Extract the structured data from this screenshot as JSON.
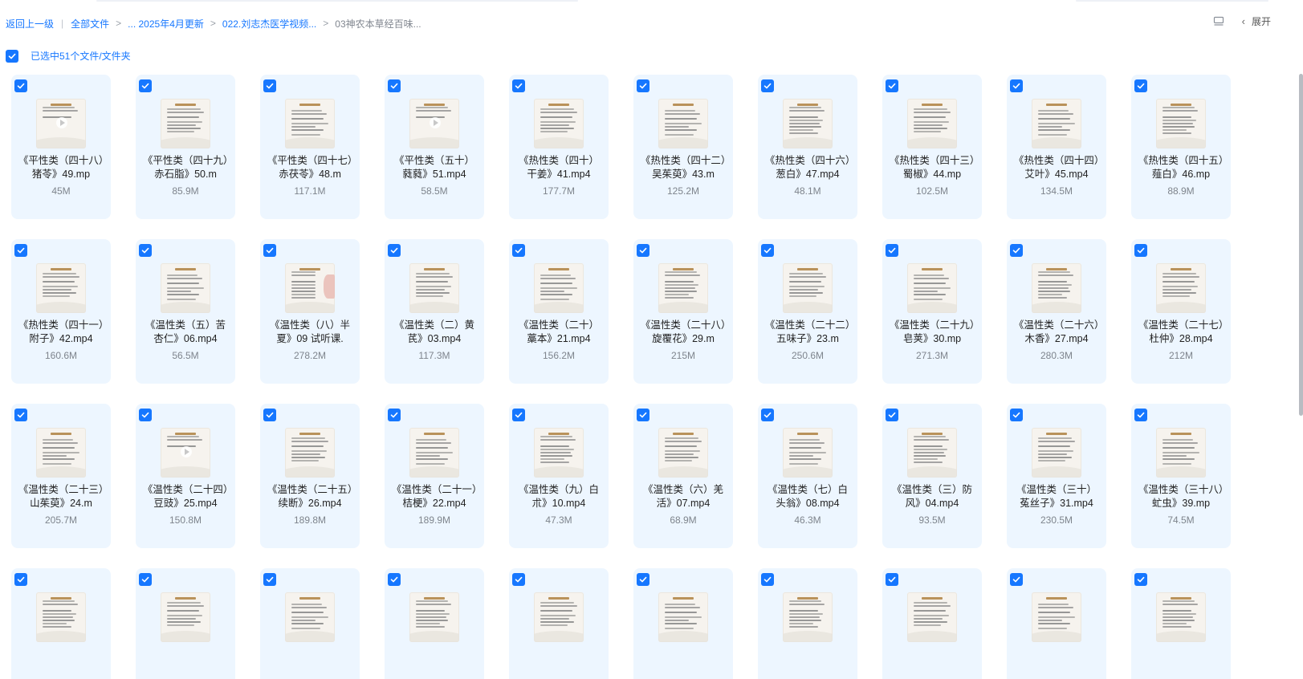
{
  "breadcrumb": {
    "back": "返回上一级",
    "items": [
      "全部文件",
      "... 2025年4月更新",
      "022.刘志杰医学视频...",
      "03神农本草经百味..."
    ]
  },
  "toolbar": {
    "list_view_icon": "list-view-icon",
    "expand_label": "展开"
  },
  "selection": {
    "label": "已选中51个文件/文件夹",
    "checked": true
  },
  "colors": {
    "accent": "#1677ff",
    "card_bg": "#edf6ff"
  },
  "files": [
    {
      "name": "《平性类（四十八）猪苓》49.mp",
      "size": "45M",
      "thumb": "cover"
    },
    {
      "name": "《平性类（四十九）赤石脂》50.m",
      "size": "85.9M",
      "thumb": "doc"
    },
    {
      "name": "《平性类（四十七）赤茯苓》48.m",
      "size": "117.1M",
      "thumb": "doc"
    },
    {
      "name": "《平性类（五十）蕤蕤》51.mp4",
      "size": "58.5M",
      "thumb": "cover"
    },
    {
      "name": "《热性类（四十）干姜》41.mp4",
      "size": "177.7M",
      "thumb": "doc"
    },
    {
      "name": "《热性类（四十二）吴茱萸》43.m",
      "size": "125.2M",
      "thumb": "doc"
    },
    {
      "name": "《热性类（四十六）葱白》47.mp4",
      "size": "48.1M",
      "thumb": "doc"
    },
    {
      "name": "《热性类（四十三）蜀椒》44.mp",
      "size": "102.5M",
      "thumb": "doc"
    },
    {
      "name": "《热性类（四十四）艾叶》45.mp4",
      "size": "134.5M",
      "thumb": "doc"
    },
    {
      "name": "《热性类（四十五）薤白》46.mp",
      "size": "88.9M",
      "thumb": "doc"
    },
    {
      "name": "《热性类（四十一）附子》42.mp4",
      "size": "160.6M",
      "thumb": "doc"
    },
    {
      "name": "《温性类（五）苦杏仁》06.mp4",
      "size": "56.5M",
      "thumb": "doc"
    },
    {
      "name": "《温性类（八）半夏》09 试听课.",
      "size": "278.2M",
      "thumb": "flower"
    },
    {
      "name": "《温性类（二）黄芪》03.mp4",
      "size": "117.3M",
      "thumb": "doc"
    },
    {
      "name": "《温性类（二十）藁本》21.mp4",
      "size": "156.2M",
      "thumb": "doc"
    },
    {
      "name": "《温性类（二十八）旋覆花》29.m",
      "size": "215M",
      "thumb": "doc"
    },
    {
      "name": "《温性类（二十二）五味子》23.m",
      "size": "250.6M",
      "thumb": "doc"
    },
    {
      "name": "《温性类（二十九）皂荚》30.mp",
      "size": "271.3M",
      "thumb": "doc"
    },
    {
      "name": "《温性类（二十六）木香》27.mp4",
      "size": "280.3M",
      "thumb": "doc"
    },
    {
      "name": "《温性类（二十七）杜仲》28.mp4",
      "size": "212M",
      "thumb": "doc"
    },
    {
      "name": "《温性类（二十三）山茱萸》24.m",
      "size": "205.7M",
      "thumb": "doc"
    },
    {
      "name": "《温性类（二十四）豆豉》25.mp4",
      "size": "150.8M",
      "thumb": "cover"
    },
    {
      "name": "《温性类（二十五）续断》26.mp4",
      "size": "189.8M",
      "thumb": "doc"
    },
    {
      "name": "《温性类（二十一）桔梗》22.mp4",
      "size": "189.9M",
      "thumb": "doc"
    },
    {
      "name": "《温性类（九）白朮》10.mp4",
      "size": "47.3M",
      "thumb": "doc"
    },
    {
      "name": "《温性类（六）羌活》07.mp4",
      "size": "68.9M",
      "thumb": "doc"
    },
    {
      "name": "《温性类（七）白头翁》08.mp4",
      "size": "46.3M",
      "thumb": "doc"
    },
    {
      "name": "《温性类（三）防风》04.mp4",
      "size": "93.5M",
      "thumb": "doc"
    },
    {
      "name": "《温性类（三十）菟丝子》31.mp4",
      "size": "230.5M",
      "thumb": "doc"
    },
    {
      "name": "《温性类（三十八）虻虫》39.mp",
      "size": "74.5M",
      "thumb": "doc"
    },
    {
      "name": "",
      "size": "",
      "thumb": "doc"
    },
    {
      "name": "",
      "size": "",
      "thumb": "doc"
    },
    {
      "name": "",
      "size": "",
      "thumb": "doc"
    },
    {
      "name": "",
      "size": "",
      "thumb": "doc"
    },
    {
      "name": "",
      "size": "",
      "thumb": "doc"
    },
    {
      "name": "",
      "size": "",
      "thumb": "doc"
    },
    {
      "name": "",
      "size": "",
      "thumb": "doc"
    },
    {
      "name": "",
      "size": "",
      "thumb": "doc"
    },
    {
      "name": "",
      "size": "",
      "thumb": "doc"
    },
    {
      "name": "",
      "size": "",
      "thumb": "doc"
    }
  ]
}
